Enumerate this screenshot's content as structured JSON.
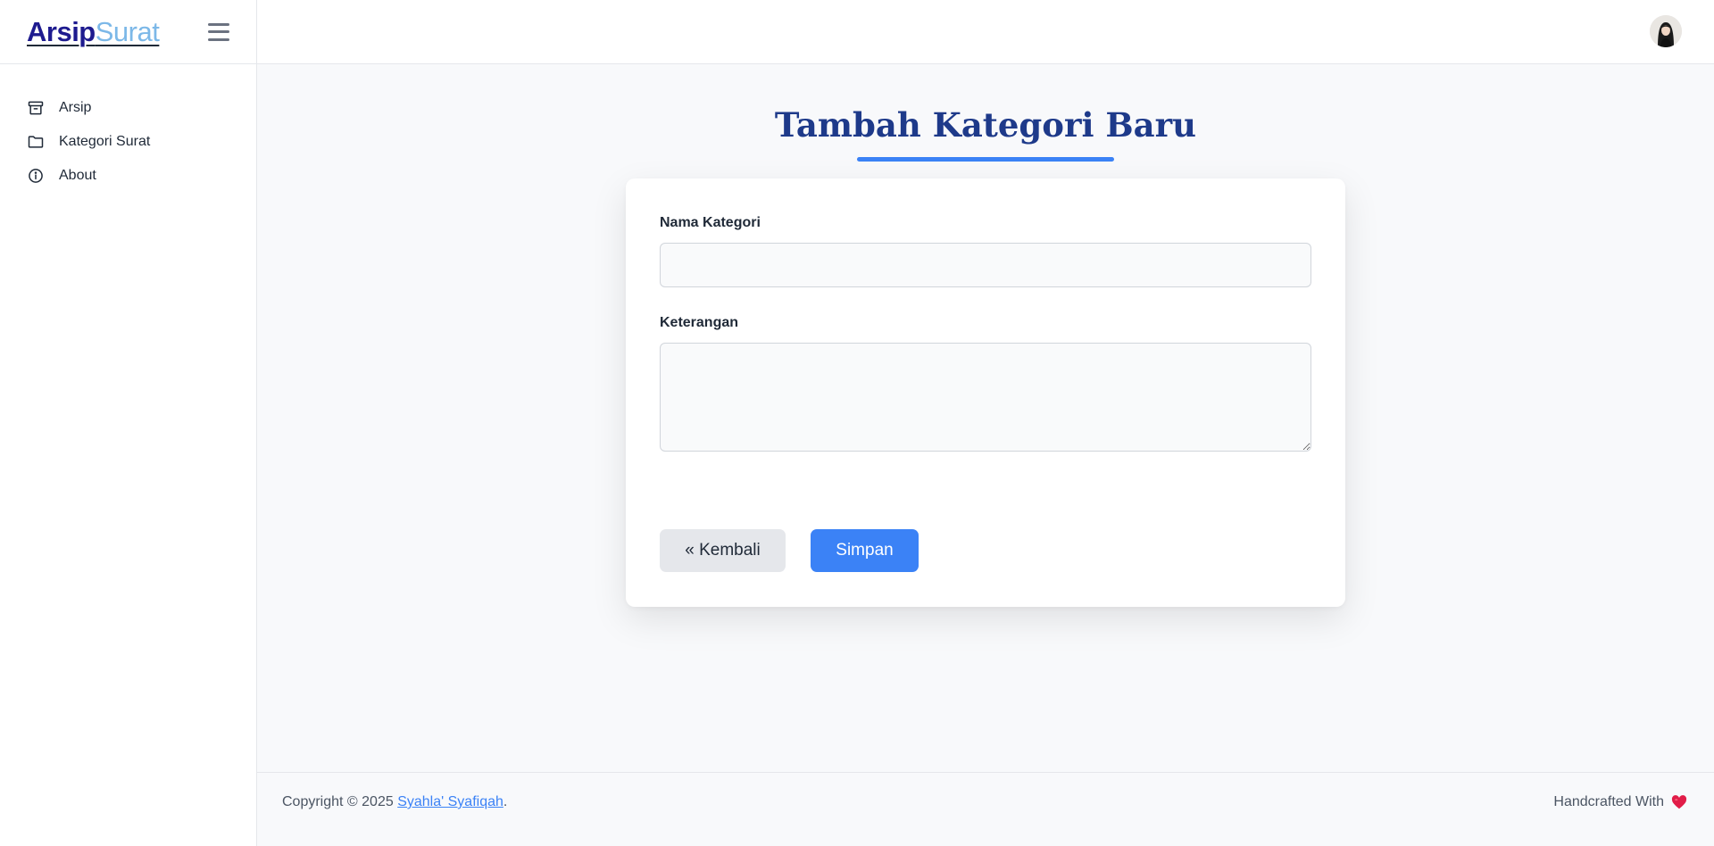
{
  "brand": {
    "part1": "Arsip",
    "part2": "Surat"
  },
  "sidebar": {
    "items": [
      {
        "label": "Arsip",
        "icon": "archive-icon"
      },
      {
        "label": "Kategori Surat",
        "icon": "folder-icon"
      },
      {
        "label": "About",
        "icon": "info-icon"
      }
    ]
  },
  "main": {
    "title": "Tambah Kategori Baru",
    "form": {
      "name_label": "Nama Kategori",
      "name_value": "",
      "desc_label": "Keterangan",
      "desc_value": "",
      "back_label": "« Kembali",
      "save_label": "Simpan"
    }
  },
  "footer": {
    "copyright_prefix": "Copyright © 2025 ",
    "author": "Syahla' Syafiqah",
    "copyright_suffix": ".",
    "handcrafted": "Handcrafted With"
  },
  "colors": {
    "accent": "#3b82f6",
    "title": "#1e3a8a",
    "brand_dark": "#1e1b8f",
    "brand_light": "#7cb8e8",
    "heart": "#e11d48"
  }
}
